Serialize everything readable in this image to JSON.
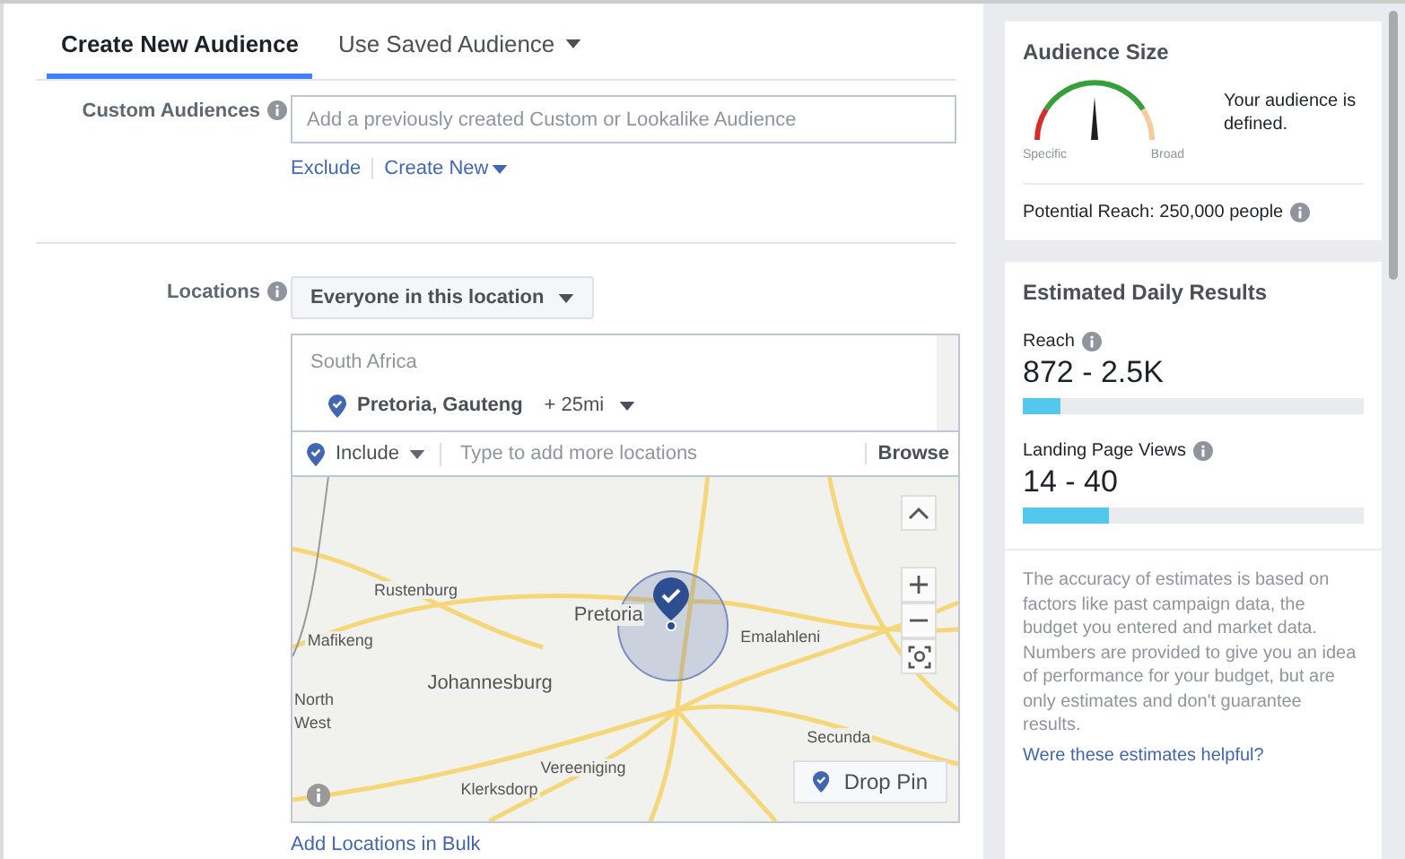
{
  "tabs": [
    {
      "label": "Create New Audience",
      "selected": true,
      "dropdown": false
    },
    {
      "label": "Use Saved Audience",
      "selected": false,
      "dropdown": true
    }
  ],
  "custom_audiences": {
    "label": "Custom Audiences",
    "placeholder": "Add a previously created Custom or Lookalike Audience",
    "links": [
      "Exclude",
      "Create New"
    ]
  },
  "locations": {
    "label": "Locations",
    "type_dropdown": "Everyone in this location",
    "country": "South Africa",
    "location": {
      "name": "Pretoria, Gauteng",
      "radius": "+ 25mi"
    },
    "include_dropdown": "Include",
    "search_placeholder": "Type to add more locations",
    "browse": "Browse",
    "map": {
      "labels": [
        {
          "text": "Rustenburg",
          "kind": "town"
        },
        {
          "text": "Pretoria",
          "kind": "city"
        },
        {
          "text": "Mafikeng",
          "kind": "town"
        },
        {
          "text": "Emalahleni",
          "kind": "town"
        },
        {
          "text": "Johannesburg",
          "kind": "city"
        },
        {
          "text": "North",
          "kind": "town"
        },
        {
          "text": "West",
          "kind": "town"
        },
        {
          "text": "Secunda",
          "kind": "town"
        },
        {
          "text": "Vereeniging",
          "kind": "town"
        },
        {
          "text": "Klerksdorp",
          "kind": "town"
        }
      ],
      "drop_pin": "Drop Pin"
    },
    "bulk_link": "Add Locations in Bulk"
  },
  "audience_size": {
    "title": "Audience Size",
    "gauge_low": "Specific",
    "gauge_high": "Broad",
    "status": "Your audience is defined.",
    "potential_reach": "Potential Reach: 250,000 people"
  },
  "estimated_daily_results": {
    "title": "Estimated Daily Results",
    "metrics": [
      {
        "label": "Reach",
        "value": "872 - 2.5K",
        "level": 0.11
      },
      {
        "label": "Landing Page Views",
        "value": "14 - 40",
        "level": 0.25
      }
    ],
    "note": "The accuracy of estimates is based on factors like past campaign data, the budget you entered and market data. Numbers are provided to give you an idea of performance for your budget, but are only estimates and don't guarantee results.",
    "feedback_link": "Were these estimates helpful?"
  }
}
